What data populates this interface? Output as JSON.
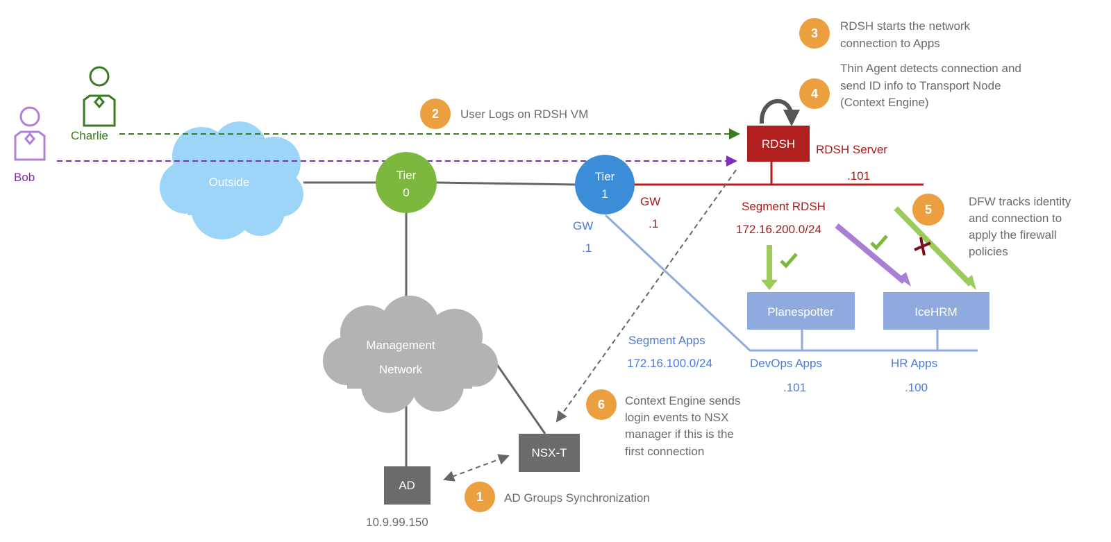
{
  "users": [
    {
      "name": "Bob",
      "color": "#b07fd6"
    },
    {
      "name": "Charlie",
      "color": "#3a7a22"
    }
  ],
  "clouds": {
    "outside": "Outside",
    "management": [
      "Management",
      "Network"
    ]
  },
  "routers": {
    "tier0": [
      "Tier",
      "0"
    ],
    "tier1": [
      "Tier",
      "1"
    ]
  },
  "gateways": {
    "tier1_rdsh": {
      "label": "GW",
      "ip": ".1"
    },
    "tier1_apps": {
      "label": "GW",
      "ip": ".1"
    }
  },
  "rdsh": {
    "box": "RDSH",
    "label": "RDSH Server",
    "ip": ".101"
  },
  "segment_rdsh": {
    "name": "Segment RDSH",
    "cidr": "172.16.200.0/24"
  },
  "segment_apps": {
    "name": "Segment Apps",
    "cidr": "172.16.100.0/24"
  },
  "apps": [
    {
      "box": "Planespotter",
      "group": "DevOps Apps",
      "ip": ".101"
    },
    {
      "box": "IceHRM",
      "group": "HR Apps",
      "ip": ".100"
    }
  ],
  "nsx": {
    "box": "NSX-T"
  },
  "ad": {
    "box": "AD",
    "ip": "10.9.99.150"
  },
  "steps": [
    {
      "n": "1",
      "lines": [
        "AD Groups Synchronization"
      ]
    },
    {
      "n": "2",
      "lines": [
        "User Logs on RDSH VM"
      ]
    },
    {
      "n": "3",
      "lines": [
        "RDSH starts the network",
        "connection to Apps"
      ]
    },
    {
      "n": "4",
      "lines": [
        "Thin Agent detects connection and",
        "send ID info to Transport Node",
        "(Context Engine)"
      ]
    },
    {
      "n": "5",
      "lines": [
        "DFW tracks identity",
        "and connection to",
        "apply the firewall",
        "policies"
      ]
    },
    {
      "n": "6",
      "lines": [
        "Context Engine sends",
        "login events to NSX",
        "manager if this is the",
        "first connection"
      ]
    }
  ],
  "colors": {
    "step": "#eb9f3f",
    "rdsh": "#b01e1e",
    "app_box": "#8eaadf",
    "tier0": "#7db83e",
    "tier1": "#3a8dd6",
    "allow": "#9ccb5c",
    "deny": "#7a1020"
  }
}
